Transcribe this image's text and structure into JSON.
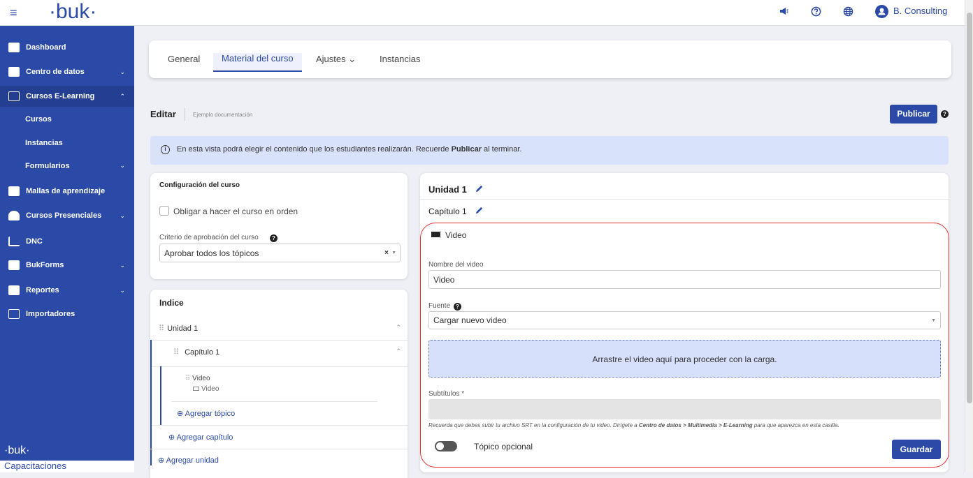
{
  "topbar": {
    "logo": "·buk·",
    "menu_icon": "hamburger-icon",
    "icons": [
      "megaphone-icon",
      "help-circle-icon",
      "globe-icon"
    ],
    "user_name": "B. Consulting"
  },
  "sidebar": {
    "items": [
      {
        "label": "Dashboard"
      },
      {
        "label": "Centro de datos"
      },
      {
        "label": "Cursos E-Learning"
      },
      {
        "label": "Mallas de aprendizaje"
      },
      {
        "label": "Cursos Presenciales"
      },
      {
        "label": "DNC"
      },
      {
        "label": "BukForms"
      },
      {
        "label": "Reportes"
      },
      {
        "label": "Importadores"
      }
    ],
    "subitems": [
      {
        "label": "Cursos"
      },
      {
        "label": "Instancias"
      },
      {
        "label": "Formularios"
      }
    ],
    "footer_logo": "·buk·",
    "footer_text": "Capacitaciones"
  },
  "tabs": [
    {
      "label": "General"
    },
    {
      "label": "Material del curso"
    },
    {
      "label": "Ajustes ⌄"
    },
    {
      "label": "Instancias"
    }
  ],
  "header": {
    "edit_label": "Editar",
    "course_name": "Ejemplo documentación",
    "publish_label": "Publicar"
  },
  "info": {
    "text_before": "En esta vista podrá elegir el contenido que los estudiantes realizarán. Recuerde ",
    "text_bold": "Publicar",
    "text_after": " al terminar."
  },
  "config": {
    "title": "Configuración del curso",
    "checkbox_label": "Obligar a hacer el curso en orden",
    "criteria_label": "Criterio de aprobación del curso",
    "criteria_value": "Aprobar todos los tópicos"
  },
  "index": {
    "title": "Indice",
    "unit": "Unidad 1",
    "chapter": "Capítulo 1",
    "topic": "Video",
    "topic_type": "Video",
    "add_topic": "Agregar tópico",
    "add_chapter": "Agregar capítulo",
    "add_unit": "Agregar unidad"
  },
  "editor": {
    "unit_title": "Unidad 1",
    "chapter_title": "Capítulo 1",
    "topic_type": "Video",
    "video_name_label": "Nombre del video",
    "video_name_value": "Video",
    "source_label": "Fuente",
    "source_value": "Cargar nuevo video",
    "dropzone_text": "Arrastre el video aquí para proceder con la carga.",
    "subtitles_label": "Subtítulos *",
    "note_before": "Recuerda que debes subir tu archivo SRT en la configuración de tu video. Dirígete a ",
    "note_bold": "Centro de datos > Multimedia > E-Learning",
    "note_after": " para que aparezca en esta casilla.",
    "optional_label": "Tópico opcional",
    "optional_on": false,
    "save_label": "Guardar"
  },
  "colors": {
    "primary": "#2b4aa8",
    "highlight": "#e03030",
    "info_bg": "#d9e2fb"
  }
}
